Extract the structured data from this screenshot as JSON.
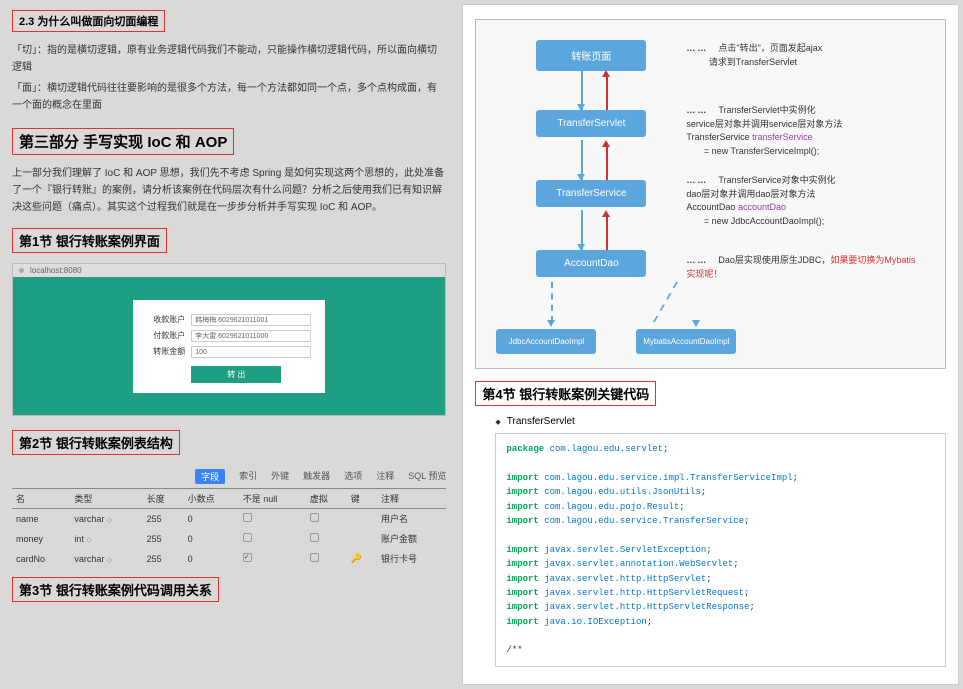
{
  "left": {
    "h23": "2.3 为什么叫做面向切面编程",
    "p1": "「切」：指的是横切逻辑，原有业务逻辑代码我们不能动，只能操作横切逻辑代码，所以面向横切逻辑",
    "p2": "「面」：横切逻辑代码往往要影响的是很多个方法，每一个方法都如同一个点，多个点构成面，有一个面的概念在里面",
    "hpart": "第三部分 手写实现 IoC 和 AOP",
    "p3": "上一部分我们理解了 IoC 和 AOP 思想，我们先不考虑 Spring 是如何实现这两个思想的，此处准备了一个『银行转账』的案例，请分析该案例在代码层次有什么问题？分析之后使用我们已有知识解决这些问题（痛点）。其实这个过程我们就是在一步步分析并手写实现 IoC 和 AOP。",
    "hsec1": "第1节 银行转账案例界面",
    "browser_url": "localhost:8080",
    "form": {
      "l1": "收款账户",
      "v1": "韩梅梅 6029621011001",
      "l2": "付款账户",
      "v2": "李大雷 6029621011000",
      "l3": "转账金额",
      "v3": "100",
      "btn": "转 出"
    },
    "hsec2": "第2节 银行转账案例表结构",
    "tabs": [
      "字段",
      "索引",
      "外键",
      "触发器",
      "选项",
      "注释",
      "SQL 预览"
    ],
    "thead": [
      "名",
      "类型",
      "长度",
      "小数点",
      "不是 null",
      "虚拟",
      "键",
      "注释"
    ],
    "rows": [
      {
        "name": "name",
        "type": "varchar",
        "len": "255",
        "dec": "0",
        "nn": false,
        "virt": false,
        "key": "",
        "comment": "用户名"
      },
      {
        "name": "money",
        "type": "int",
        "len": "255",
        "dec": "0",
        "nn": false,
        "virt": false,
        "key": "",
        "comment": "账户金额"
      },
      {
        "name": "cardNo",
        "type": "varchar",
        "len": "255",
        "dec": "0",
        "nn": true,
        "virt": false,
        "key": "🔑",
        "comment": "银行卡号"
      }
    ],
    "hsec3": "第3节 银行转账案例代码调用关系"
  },
  "right": {
    "nodes": {
      "n1": "转账页面",
      "n2": "TransferServlet",
      "n3": "TransferService",
      "n4": "AccountDao",
      "n5": "JdbcAccountDaoImpl",
      "n6": "MybatisAccountDaoImpl"
    },
    "desc1a": "点击\"转出\"，页面发起ajax",
    "desc1b": "请求到TransferServlet",
    "desc2a": "TransferServlet中实例化",
    "desc2b": "service层对象并调用service层对象方法",
    "desc2c": "TransferService ",
    "desc2d": "transferService",
    "desc2e": " = new TransferServiceImpl();",
    "desc3a": "TransferService对象中实例化",
    "desc3b": "dao层对象并调用dao层对象方法",
    "desc3c": "AccountDao ",
    "desc3d": "accountDao",
    "desc3e": " = new JdbcAccountDaoImpl();",
    "desc4a": "Dao层实现使用原生JDBC，",
    "desc4b": "如果要切换为Mybatis实现呢！",
    "hsec4": "第4节 银行转账案例关键代码",
    "bullet": "TransferServlet",
    "code": {
      "l1a": "package ",
      "l1b": "com.lagou.edu.servlet",
      "l1c": ";",
      "l3a": "import ",
      "l3b": "com.lagou.edu.service.impl.TransferServiceImpl",
      "l3c": ";",
      "l4a": "import ",
      "l4b": "com.lagou.edu.utils.JsonUtils",
      "l4c": ";",
      "l5a": "import ",
      "l5b": "com.lagou.edu.pojo.Result",
      "l5c": ";",
      "l6a": "import ",
      "l6b": "com.lagou.edu.service.TransferService",
      "l6c": ";",
      "l8a": "import ",
      "l8b": "javax.servlet.ServletException",
      "l8c": ";",
      "l9a": "import ",
      "l9b": "javax.servlet.annotation.WebServlet",
      "l9c": ";",
      "l10a": "import ",
      "l10b": "javax.servlet.http.HttpServlet",
      "l10c": ";",
      "l11a": "import ",
      "l11b": "javax.servlet.http.HttpServletRequest",
      "l11c": ";",
      "l12a": "import ",
      "l12b": "javax.servlet.http.HttpServletResponse",
      "l12c": ";",
      "l13a": "import ",
      "l13b": "java.io.IOException",
      "l13c": ";",
      "l15": "/**"
    }
  }
}
